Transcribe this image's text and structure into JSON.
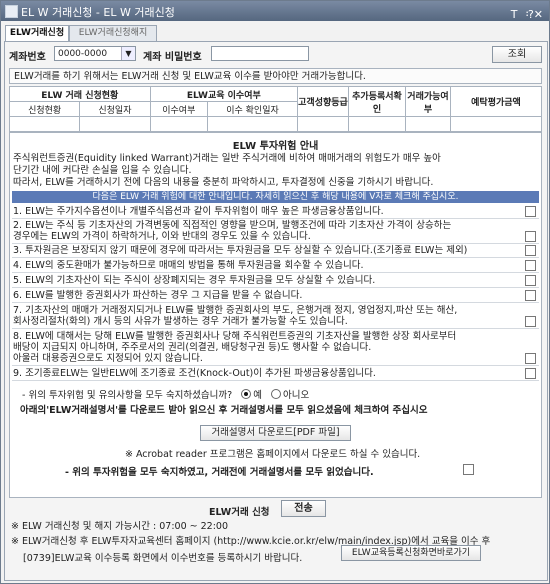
{
  "window": {
    "title": "EL W 거래신청 - EL W 거래신청",
    "buttons": [
      "T",
      "᠄",
      "?",
      "✕"
    ]
  },
  "tabs": [
    {
      "label": "ELW거래신청",
      "active": true
    },
    {
      "label": "ELW거래신청해지",
      "active": false
    }
  ],
  "account": {
    "number_label": "계좌번호",
    "number_value": "0000-0000",
    "password_label": "계좌 비밀번호",
    "inquiry_button": "조회"
  },
  "notice": "ELW거래를 하기 위해서는  ELW거래 신청 및 ELW교육 이수를 받아야만 거래가능합니다.",
  "status_table": {
    "group_headers": [
      "ELW 거래 신청현황",
      "ELW교육 이수여부",
      "고객성향등급",
      "추가등록서확인",
      "거래가능여부",
      "예탁평가금액"
    ],
    "sub_headers": [
      "신청현황",
      "신청일자",
      "이수여부",
      "이수 확인일자"
    ]
  },
  "risk": {
    "title": "ELW 투자위험 안내",
    "intro": [
      "주식워런트증권(Equidity linked Warrant)거래는 일반 주식거래에 비하여 매매거래의 위험도가 매우 높아",
      "단기간 내에 커다란 손실을 입을 수 있습니다.",
      "따라서, ELW를 거래하시기 전에 다음의 내용을 충분히 파악하시고, 투자결정에 신중을 기하시기 바랍니다."
    ],
    "bar_text": "다음은 ELW 거래 위험에 대한 안내입니다. 자세히 읽으신 후 해당 내용에 V자로 체크해 주십시오.",
    "items": [
      {
        "lines": [
          "1. ELW는 주가지수옵션이나 개별주식옵션과 같이 투자위험이 매우 높은 파생금융상품입니다."
        ]
      },
      {
        "lines": [
          "2. ELW는 주식 등 기초자산의 가격변동에 직접적인 영향을 받으며, 발행조건에 따라 기초자산 가격이 상승하는",
          "   경우에는 ELW의 가격이 하락하거나, 이와 반대의 경우도 있을 수 있습니다."
        ]
      },
      {
        "lines": [
          "3. 투자원금은 보장되지 않기 때문에 경우에 따라서는 투자원금을 모두 상실할 수 있습니다.(조기종료 ELW는 제외)"
        ]
      },
      {
        "lines": [
          "4. ELW의 중도환매가 불가능하므로 매매의 방법을 통해 투자원금을 회수할 수 있습니다."
        ]
      },
      {
        "lines": [
          "5. ELW의 기초자산이 되는 주식이 상장폐지되는 경우 투자원금을 모두 상실할 수 있습니다."
        ]
      },
      {
        "lines": [
          "6. ELW를 발행한 증권회사가 파산하는 경우 그 지급을 받을 수 없습니다."
        ]
      },
      {
        "lines": [
          "7. 기초자산의 매매가 거래정지되거나 ELW를 발행한 증권회사의 부도, 은행거래 정지, 영업정지,파산 또는 해산,",
          "   회사정리절차(화의) 개시 등의 사유가 발생하는 경우 거래가 불가능할 수도 있습니다."
        ]
      },
      {
        "lines": [
          "8. ELW에 대해서는 당해 ELW를 발행한 증권회사나 당해 주식워런트증권의 기초자산을 발행한 상장 회사로부터",
          "   배당이 지급되지 아니하며, 주주로서의 권리(의결권, 배당청구권 등)도 행사할 수 없습니다.",
          "   아울러 대용증권으로도 지정되어 있지 않습니다."
        ]
      },
      {
        "lines": [
          "9. 조기종료ELW는 일반ELW에 조기종료 조건(Knock-Out)이 추가된 파생금융상품입니다."
        ]
      }
    ],
    "agree_question": "- 위의 투자위험 및 유의사항을 모두 숙지하셨습니까?",
    "yes_label": "예",
    "no_label": "아니오",
    "download_notice": "아래의'ELW거래설명서'를 다운로드 받아 읽으신 후 거래설명서를 모두 읽으셨음에 체크하여 주십시오",
    "download_button": "거래설명서 다운로드[PDF 파일]",
    "acrobat_note": "※ Acrobat reader 프로그램은 홈페이지에서 다운로드 하실 수 있습니다.",
    "final_confirm": "- 위의 투자위험을 모두 숙지하였고, 거래전에 거래설명서를 모두 읽었습니다."
  },
  "apply": {
    "label": "ELW거래 신청",
    "send_button": "전송",
    "hours_note": "※ ELW 거래신청 및 해지 가능시간 : 07:00 ~ 22:00",
    "edu_note1": "※ ELW거래신청 후 ELW투자자교육센터 홈페이지 (http://www.kcie.or.kr/elw/main/index.jsp)에서 교육을 이수 후",
    "edu_note2": "[0739]ELW교육 이수등록 화면에서 이수번호를 등록하시기 바랍니다.",
    "edu_button": "ELW교육등록신청화면바로가기"
  }
}
